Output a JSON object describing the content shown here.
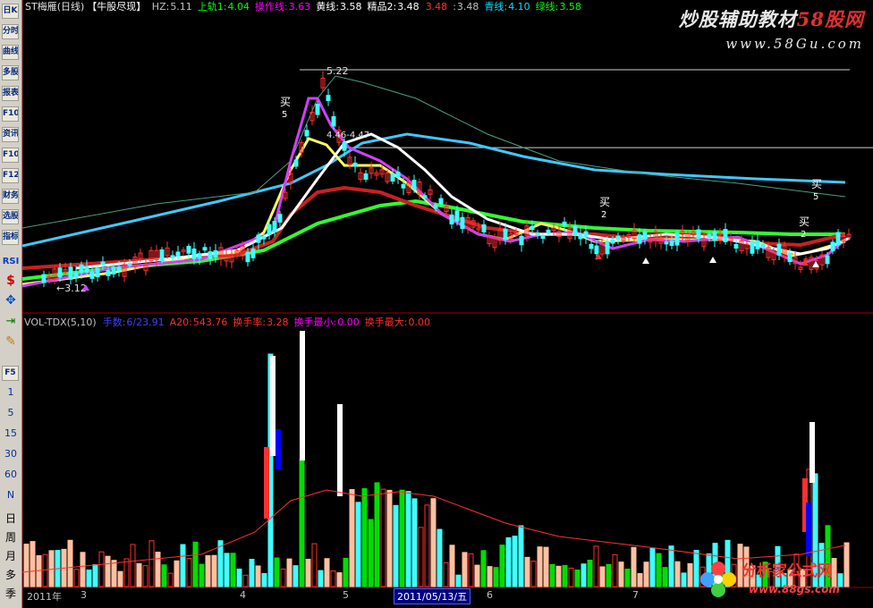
{
  "window": {
    "title": "ST梅雁(日线)"
  },
  "indicator_name": "【牛股尽现】",
  "main_header": [
    {
      "label": "HZ:",
      "value": "5.11",
      "color": "#c0c0c0"
    },
    {
      "label": "上轨1:",
      "value": "4.04",
      "color": "#00ff00"
    },
    {
      "label": "操作线:",
      "value": "3.63",
      "color": "#ff00ff"
    },
    {
      "label": "黄线:",
      "value": "3.58",
      "color": "#ffffff"
    },
    {
      "label": "精品2:",
      "value": "3.48",
      "color": "#ffffff"
    },
    {
      "label": "",
      "value": "3.48",
      "color": "#ff3030"
    },
    {
      "label": ":",
      "value": "3.48",
      "color": "#c0c0c0"
    },
    {
      "label": "青线:",
      "value": "4.10",
      "color": "#00e0ff"
    },
    {
      "label": "绿线:",
      "value": "3.58",
      "color": "#00ff00"
    }
  ],
  "vol_header": [
    {
      "label": "VOL-TDX(5,10)",
      "value": "",
      "color": "#c0c0c0"
    },
    {
      "label": "手数:",
      "value": "6/23.91",
      "color": "#4040ff"
    },
    {
      "label": "A20:",
      "value": "543.76",
      "color": "#ff3030"
    },
    {
      "label": "换手率:",
      "value": "3.28",
      "color": "#ff3030"
    },
    {
      "label": "换手最小:",
      "value": "0.00",
      "color": "#ff00ff"
    },
    {
      "label": "换手最大:",
      "value": "0.00",
      "color": "#ff3030"
    }
  ],
  "watermark_top": {
    "title_a": "炒股辅助教材",
    "title_b": "58股网",
    "url": "www.58Gu.com"
  },
  "watermark_bottom": {
    "brand": "分析家公式网",
    "url": "www.88gs.com"
  },
  "toolbar": {
    "buttons": [
      "日K",
      "分时",
      "曲线",
      "多股",
      "报表",
      "F10",
      "资讯",
      "F10",
      "F12",
      "财务",
      "选股",
      "指标"
    ],
    "rsi": "RSI",
    "fs": "F5",
    "periods": [
      "1",
      "5",
      "15",
      "30",
      "60",
      "N"
    ],
    "cn_periods": [
      "日",
      "周",
      "月",
      "多",
      "季"
    ]
  },
  "annotations": {
    "high": "5.22",
    "low": "←3.12",
    "range": "4.46-4.47",
    "buy_label": "买",
    "buy_counts": [
      "5",
      "2",
      "5",
      "2"
    ]
  },
  "x_axis": {
    "year": "2011年",
    "months": [
      "3",
      "4",
      "5",
      "6",
      "7"
    ],
    "cursor": "2011/05/13/五"
  },
  "chart_data": {
    "type": "candlestick+volume",
    "price_high": 5.22,
    "price_low": 3.12,
    "price_range_annotation": "4.46-4.47",
    "last_close": 3.48,
    "indicators": {
      "HZ": 5.11,
      "上轨1": 4.04,
      "操作线": 3.63,
      "黄线": 3.58,
      "精品2": 3.48,
      "青线": 4.1,
      "绿线": 3.58
    },
    "volume": {
      "A20": 543.76,
      "turnover": 3.28,
      "turnover_min": 0.0,
      "turnover_max": 0.0
    }
  },
  "colors": {
    "background": "#000000",
    "up": "#ff3030",
    "down": "#40ffff",
    "magenta": "#d040ff",
    "yellow": "#ffff60",
    "white": "#ffffff",
    "cyan_line": "#40c8ff",
    "green_line": "#30ff30",
    "red_line": "#cc2020",
    "volume_pink": "#ffc0a0",
    "volume_blue": "#0000ff",
    "volume_green": "#00dd00"
  }
}
